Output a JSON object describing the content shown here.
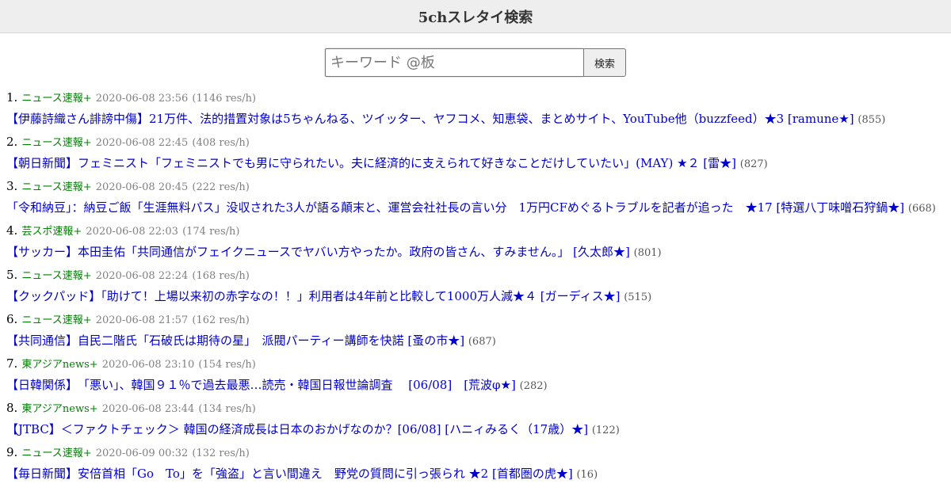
{
  "header": {
    "title": "5chスレタイ検索"
  },
  "search": {
    "placeholder": "キーワード @板",
    "value": "",
    "button_label": "検索"
  },
  "results": [
    {
      "num": "1.",
      "board": "ニュース速報+",
      "date": "2020-06-08 23:56",
      "speed": "(1146 res/h)",
      "title": "【伊藤詩織さん誹謗中傷】21万件、法的措置対象は5ちゃんねる、ツイッター、ヤフコメ、知恵袋、まとめサイト、YouTube他（buzzfeed）★3 [ramune★]",
      "count": "(855)"
    },
    {
      "num": "2.",
      "board": "ニュース速報+",
      "date": "2020-06-08 22:45",
      "speed": "(408 res/h)",
      "title": "【朝日新聞】フェミニスト「フェミニストでも男に守られたい。夫に経済的に支えられて好きなことだけしていたい」(MAY) ★２ [雷★]",
      "count": "(827)"
    },
    {
      "num": "3.",
      "board": "ニュース速報+",
      "date": "2020-06-08 20:45",
      "speed": "(222 res/h)",
      "title": "「令和納豆」：納豆ご飯「生涯無料パス」没収された3人が語る顛末と、運営会社社長の言い分　1万円CFめぐるトラブルを記者が追った　★17 [特選八丁味噌石狩鍋★]",
      "count": "(668)"
    },
    {
      "num": "4.",
      "board": "芸スポ速報+",
      "date": "2020-06-08 22:03",
      "speed": "(174 res/h)",
      "title": "【サッカー】本田圭佑「共同通信がフェイクニュースでヤバい方やったか。政府の皆さん、すみません。」 [久太郎★]",
      "count": "(801)"
    },
    {
      "num": "5.",
      "board": "ニュース速報+",
      "date": "2020-06-08 22:24",
      "speed": "(168 res/h)",
      "title": "【クックパッド】「助けて！上場以来初の赤字なの！！」利用者は4年前と比較して1000万人減★４ [ガーディス★]",
      "count": "(515)"
    },
    {
      "num": "6.",
      "board": "ニュース速報+",
      "date": "2020-06-08 21:57",
      "speed": "(162 res/h)",
      "title": "【共同通信】自民二階氏「石破氏は期待の星」　派閥パーティー講師を快諾 [蚤の市★]",
      "count": "(687)"
    },
    {
      "num": "7.",
      "board": "東アジアnews+",
      "date": "2020-06-08 23:10",
      "speed": "(154 res/h)",
      "title": "【日韓関係】　「悪い」、韓国９１％で過去最悪…読売・韓国日報世論調査　 [06/08]　[荒波φ★]",
      "count": "(282)"
    },
    {
      "num": "8.",
      "board": "東アジアnews+",
      "date": "2020-06-08 23:44",
      "speed": "(134 res/h)",
      "title": "【JTBC】＜ファクトチェック＞ 韓国の経済成長は日本のおかげなのか？[06/08] [ハニィみるく（17歳）★]",
      "count": "(122)"
    },
    {
      "num": "9.",
      "board": "ニュース速報+",
      "date": "2020-06-09 00:32",
      "speed": "(132 res/h)",
      "title": "【毎日新聞】安倍首相「Go　To」を「強盗」と言い間違え　野党の質問に引っ張られ ★2 [首都圏の虎★]",
      "count": "(16)"
    }
  ]
}
